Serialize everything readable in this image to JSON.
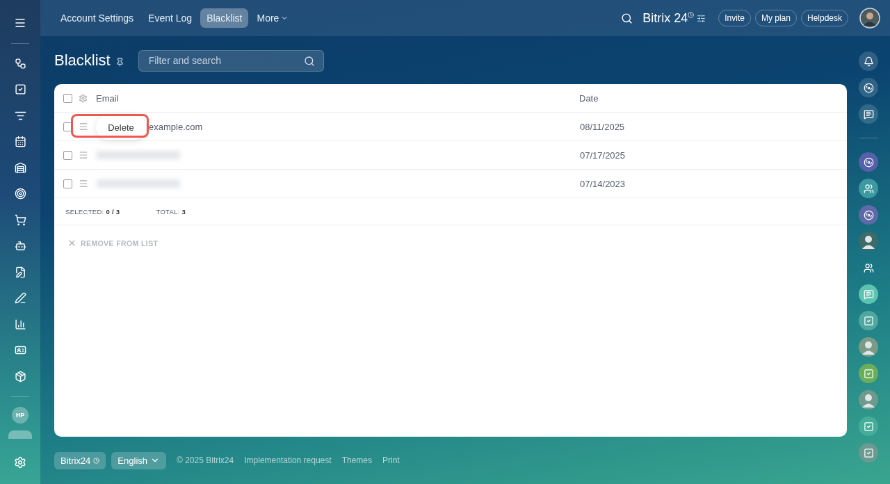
{
  "top_nav": {
    "tabs": [
      {
        "label": "Account Settings",
        "selected": false
      },
      {
        "label": "Event Log",
        "selected": false
      },
      {
        "label": "Blacklist",
        "selected": true
      }
    ],
    "more": "More",
    "brand": "Bitrix 24",
    "buttons": [
      "Invite",
      "My plan",
      "Helpdesk"
    ]
  },
  "left_sidebar": {
    "user_badge": "HP"
  },
  "page": {
    "title": "Blacklist",
    "search": {
      "placeholder": "Filter and search"
    }
  },
  "table": {
    "all_checked": false,
    "columns": [
      "Email",
      "Date"
    ],
    "rows": [
      {
        "email": "example.com",
        "blurred": false,
        "date": "08/11/2025",
        "checked": false
      },
      {
        "blurred": true,
        "date": "07/17/2025",
        "checked": false
      },
      {
        "blurred": true,
        "date": "07/14/2023",
        "checked": false
      }
    ],
    "row_menu": {
      "label": "Delete",
      "highlighted": true
    },
    "summary": {
      "selected_label": "SELECTED:",
      "selected_value": "0 / 3",
      "total_label": "TOTAL:",
      "total_value": "3"
    },
    "action": {
      "label": "REMOVE FROM LIST",
      "disabled": true
    }
  },
  "footer": {
    "brand": "Bitrix24",
    "language": "English",
    "links": [
      "© 2025 Bitrix24",
      "Implementation request",
      "Themes",
      "Print"
    ]
  }
}
